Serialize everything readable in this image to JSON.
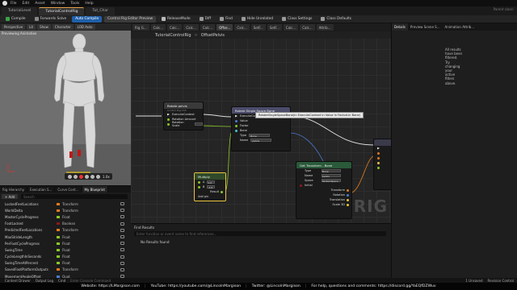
{
  "menubar": {
    "items": [
      "File",
      "Edit",
      "Asset",
      "Window",
      "Tools",
      "Help"
    ]
  },
  "tabs": [
    {
      "label": "TutorialLevel",
      "active": false
    },
    {
      "label": "TutorialControlRig",
      "active": true
    },
    {
      "label": "Tut_Char",
      "active": false
    }
  ],
  "parent_slot": "Parent class:",
  "toolbar": {
    "compile": "Compile",
    "forwards_solve": "Forwards Solve",
    "auto_compile": "Auto Compile",
    "preview": "Control Rig Editor Preview",
    "release_mode": "ReleaseMode",
    "diff": "Diff",
    "find": "Find",
    "hide_unrelated": "Hide Unrelated",
    "class_settings": "Class Settings",
    "class_defaults": "Class Defaults"
  },
  "viewport": {
    "buttons": [
      "Perspective",
      "Lit",
      "Show",
      "Character",
      "LOD Auto"
    ],
    "label": "Previewing Animation",
    "speed": "1.0x"
  },
  "left_panel": {
    "tabs": [
      "Rig Hierarchy",
      "Execution S...",
      "Curve Cont...",
      "My Blueprint"
    ],
    "add_label": "+ Add",
    "search_placeholder": "Search",
    "variables": [
      {
        "name": "LockedFeetLocations",
        "type": "Transform",
        "color": "#e07a1f"
      },
      {
        "name": "WorldDelta",
        "type": "Transform",
        "color": "#e07a1f"
      },
      {
        "name": "MasterCycleProgress",
        "type": "Float",
        "color": "#8ac926"
      },
      {
        "name": "FootLocked",
        "type": "Boolean",
        "color": "#8b1a1a"
      },
      {
        "name": "PredictedFeetLocations",
        "type": "Transform",
        "color": "#e07a1f"
      },
      {
        "name": "MaxStrideLength",
        "type": "Float",
        "color": "#8ac926"
      },
      {
        "name": "PerFootCycleProgress",
        "type": "Float",
        "color": "#8ac926"
      },
      {
        "name": "SwingTime",
        "type": "Float",
        "color": "#8ac926"
      },
      {
        "name": "CycleLengthInSeconds",
        "type": "Float",
        "color": "#8ac926"
      },
      {
        "name": "SwingTimeAtPercent",
        "type": "Float",
        "color": "#8ac926"
      },
      {
        "name": "SavedFootPlatformOutputs",
        "type": "Transform",
        "color": "#e07a1f"
      },
      {
        "name": "MovementAngleOffset",
        "type": "Quat",
        "color": "#4a7bd1"
      }
    ]
  },
  "graph": {
    "tabs": [
      "Rig G...",
      "Calc...",
      "Calc...",
      "Calc...",
      "Calc...",
      "Offse...",
      "Calc...",
      "SetF...",
      "SetF...",
      "Calc...",
      "Calc...",
      "Attrib..."
    ],
    "breadcrumb": {
      "root": "TutorialControlRig",
      "current": "OffsetPelvis"
    },
    "watermark": "RIG",
    "tooltip": "RotateSingleSpaceBone(in ExecuteContext in Value in FactorLin Bone)",
    "nodes": {
      "rotate_pelvis": {
        "title": "Rotate pelvis",
        "sub": "Control Rig Unit",
        "pins": [
          "ExecuteContext",
          "Rotation Amount",
          "Rotation Scale"
        ]
      },
      "rotate_space": {
        "title": "Rotate Single Space Bone",
        "pins": [
          "ExecuteContext",
          "Value",
          "Factor",
          "Bone"
        ],
        "type_label": "Type",
        "type_value": "Bone",
        "name_label": "Name",
        "name_value": "pelvis"
      },
      "multiply": {
        "title": "Multiply",
        "pins": [
          "A",
          "B"
        ],
        "a_value": "1.0",
        "b_value": "-1.0",
        "result": "Result",
        "add_pin": "Add pin"
      },
      "get_transform": {
        "title": "Get Transform - Bone",
        "rows": [
          "Type",
          "Name",
          "Space",
          "Initial",
          "Transform",
          "Rotation",
          "Translation",
          "Scale 3D"
        ],
        "type_value": "Bone",
        "name_value": "pelvis",
        "space_value": "Global Space"
      }
    }
  },
  "find_results": {
    "title": "Find Results",
    "placeholder": "Enter function or event name to find references...",
    "message": "No Results found"
  },
  "details": {
    "tabs": [
      "Details",
      "Preview Scene S...",
      "Animation Attrib..."
    ],
    "message": "All results have been filtered. Try changing your active filters above."
  },
  "status": {
    "content_drawer": "Content Drawer",
    "output_log": "Output Log",
    "cmd": "Cmd",
    "console_placeholder": "Enter Console Command",
    "unsaved": "1 Unsaved",
    "revision": "Revision Control"
  },
  "banner": {
    "website": "Website: https://LMargison.com",
    "youtube": "YouTube: https://youtube.com/@LincolnMargison",
    "twitter": "Twitter: @LincolnMargison",
    "discord": "For help, questions and comments: https://discord.gg/YaEQfDZWuv"
  }
}
